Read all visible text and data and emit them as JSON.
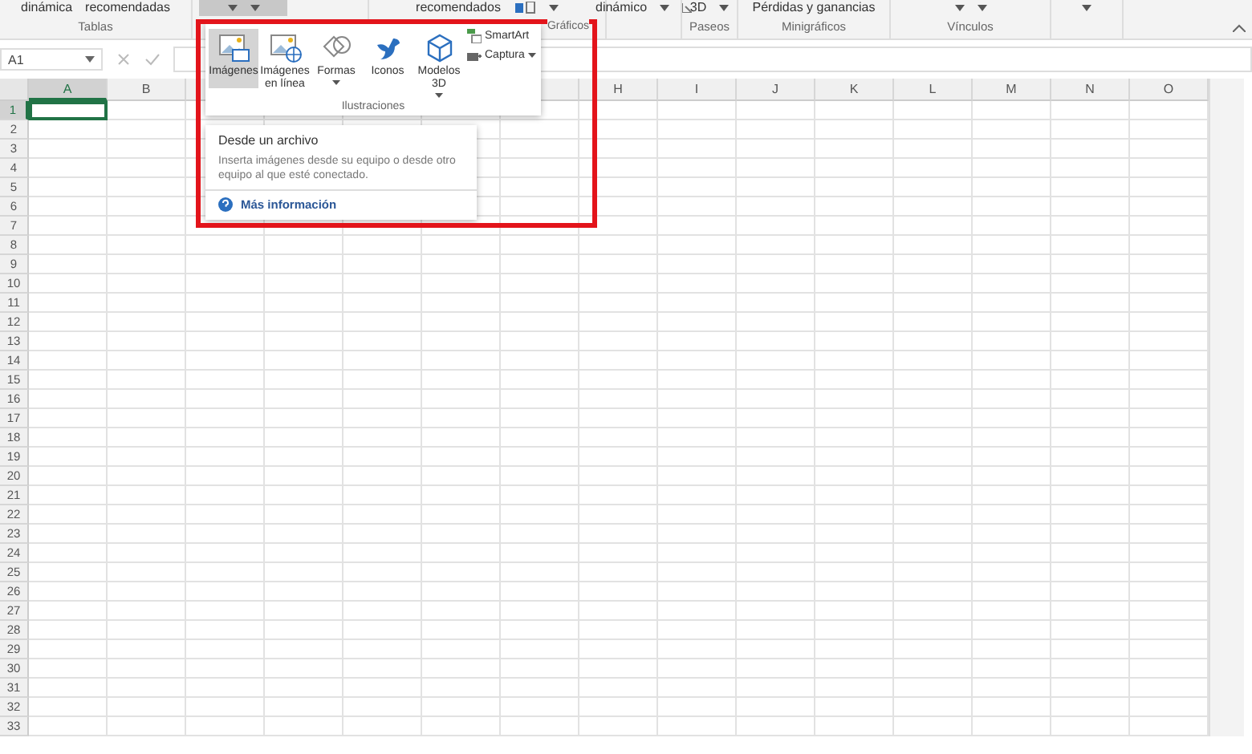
{
  "ribbon": {
    "groups": [
      {
        "top": [
          "dinámica",
          "recomendadas"
        ],
        "label": "Tablas",
        "pressed": false
      },
      {
        "pressed": true
      },
      {
        "top": [
          "recomendados"
        ],
        "label": "Gráficos",
        "pressed": false
      },
      {
        "top": [
          "dinámico"
        ],
        "pressed": false
      },
      {
        "top": [
          "3D"
        ],
        "label": "Paseos",
        "pressed": false
      },
      {
        "top": [
          "Pérdidas y ganancias"
        ],
        "label": "Minigráficos",
        "pressed": false
      },
      {
        "label": "Vínculos",
        "pressed": false
      },
      {
        "pressed": false
      }
    ]
  },
  "formula_bar": {
    "name_box": "A1"
  },
  "sheet": {
    "columns": [
      {
        "label": "A",
        "selected": true
      },
      {
        "label": "B",
        "selected": false
      },
      {
        "label": "H",
        "selected": false
      },
      {
        "label": "I",
        "selected": false
      },
      {
        "label": "J",
        "selected": false
      },
      {
        "label": "K",
        "selected": false
      },
      {
        "label": "L",
        "selected": false
      },
      {
        "label": "M",
        "selected": false
      },
      {
        "label": "N",
        "selected": false
      },
      {
        "label": "O",
        "selected": false
      }
    ],
    "rows": [
      {
        "label": "1",
        "selected": true
      },
      {
        "label": "2",
        "selected": false
      },
      {
        "label": "3",
        "selected": false
      },
      {
        "label": "4",
        "selected": false
      },
      {
        "label": "5",
        "selected": false
      },
      {
        "label": "6",
        "selected": false
      },
      {
        "label": "7",
        "selected": false
      },
      {
        "label": "8",
        "selected": false
      },
      {
        "label": "9",
        "selected": false
      },
      {
        "label": "10",
        "selected": false
      },
      {
        "label": "11",
        "selected": false
      },
      {
        "label": "12",
        "selected": false
      },
      {
        "label": "13",
        "selected": false
      },
      {
        "label": "14",
        "selected": false
      },
      {
        "label": "15",
        "selected": false
      },
      {
        "label": "16",
        "selected": false
      },
      {
        "label": "17",
        "selected": false
      },
      {
        "label": "18",
        "selected": false
      },
      {
        "label": "19",
        "selected": false
      },
      {
        "label": "20",
        "selected": false
      },
      {
        "label": "21",
        "selected": false
      },
      {
        "label": "22",
        "selected": false
      },
      {
        "label": "23",
        "selected": false
      },
      {
        "label": "24",
        "selected": false
      },
      {
        "label": "25",
        "selected": false
      },
      {
        "label": "26",
        "selected": false
      },
      {
        "label": "27",
        "selected": false
      },
      {
        "label": "28",
        "selected": false
      },
      {
        "label": "29",
        "selected": false
      },
      {
        "label": "30",
        "selected": false
      },
      {
        "label": "31",
        "selected": false
      },
      {
        "label": "32",
        "selected": false
      },
      {
        "label": "33",
        "selected": false
      }
    ]
  },
  "illustrations": {
    "buttons": [
      {
        "kind": "picture",
        "label": "Imágenes",
        "selected": true,
        "dropdown": false
      },
      {
        "kind": "online",
        "label": "Imágenes en línea",
        "selected": false,
        "dropdown": false
      },
      {
        "kind": "shapes",
        "label": "Formas",
        "selected": false,
        "dropdown": true
      },
      {
        "kind": "icons",
        "label": "Iconos",
        "selected": false,
        "dropdown": false
      },
      {
        "kind": "models",
        "label": "Modelos 3D",
        "selected": false,
        "dropdown": true
      }
    ],
    "small_buttons": [
      {
        "kind": "smartart",
        "label": "SmartArt",
        "dropdown": false
      },
      {
        "kind": "screenshot",
        "label": "Captura",
        "dropdown": true
      }
    ],
    "group_label": "Ilustraciones"
  },
  "tooltip": {
    "title": "Desde un archivo",
    "description": "Inserta imágenes desde su equipo o desde otro equipo al que esté conectado.",
    "link": "Más información"
  }
}
